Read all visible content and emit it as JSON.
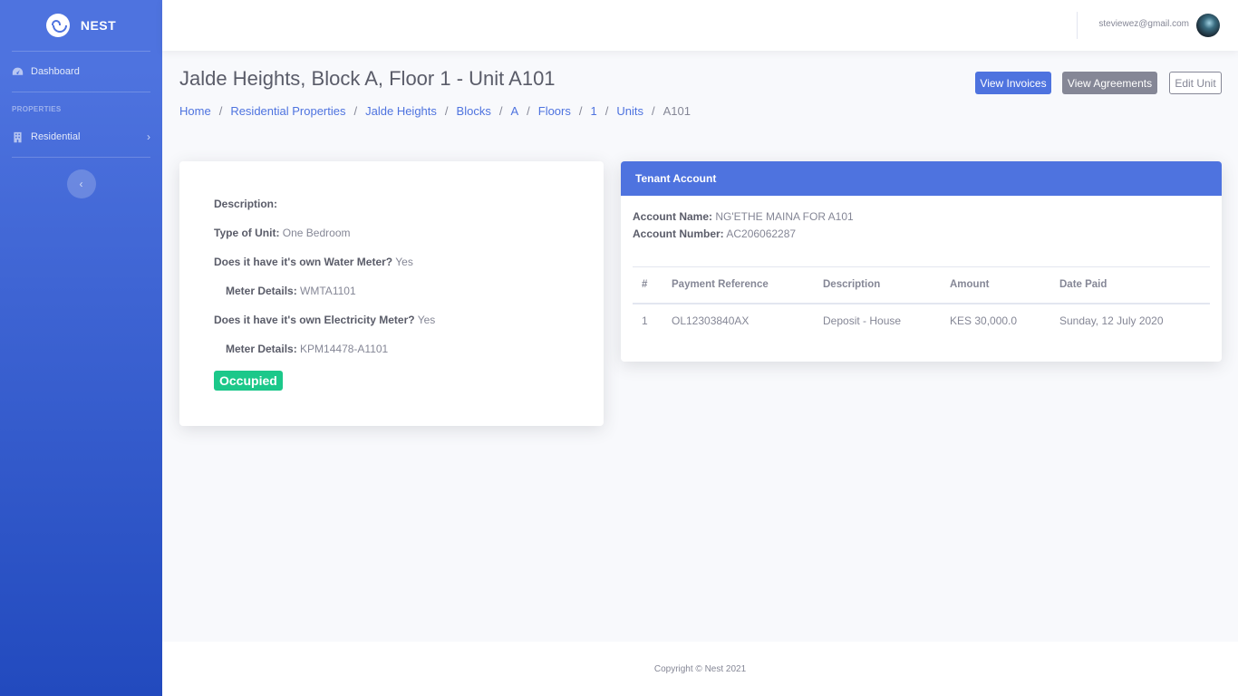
{
  "sidebar": {
    "brand": "NEST",
    "dashboard": "Dashboard",
    "heading": "PROPERTIES",
    "residential": "Residential"
  },
  "topbar": {
    "user_email": "steviewez@gmail.com"
  },
  "page": {
    "title": "Jalde Heights, Block A, Floor 1 - Unit A101",
    "breadcrumb": [
      "Home",
      "Residential Properties",
      "Jalde Heights",
      "Blocks",
      "A",
      "Floors",
      "1",
      "Units",
      "A101"
    ]
  },
  "actions": {
    "view_invoices": "View Invoices",
    "view_agreements": "View Agreements",
    "edit_unit": "Edit Unit"
  },
  "unit": {
    "description_label": "Description:",
    "description_value": "",
    "type_label": "Type of Unit:",
    "type_value": "One Bedroom",
    "water_label": "Does it have it's own Water Meter?",
    "water_value": "Yes",
    "water_meter_label": "Meter Details:",
    "water_meter_value": "WMTA1101",
    "elec_label": "Does it have it's own Electricity Meter?",
    "elec_value": "Yes",
    "elec_meter_label": "Meter Details:",
    "elec_meter_value": "KPM14478-A1101",
    "status": "Occupied"
  },
  "tenant": {
    "header": "Tenant Account",
    "account_name_label": "Account Name:",
    "account_name": "NG'ETHE MAINA FOR A101",
    "account_number_label": "Account Number:",
    "account_number": "AC206062287",
    "columns": [
      "#",
      "Payment Reference",
      "Description",
      "Amount",
      "Date Paid"
    ],
    "rows": [
      [
        "1",
        "OL12303840AX",
        "Deposit - House",
        "KES 30,000.0",
        "Sunday, 12 July 2020"
      ]
    ]
  },
  "footer": {
    "copyright": "Copyright © Nest 2021"
  },
  "colors": {
    "primary": "#4e73df",
    "secondary": "#858796",
    "success": "#1cc88a"
  }
}
